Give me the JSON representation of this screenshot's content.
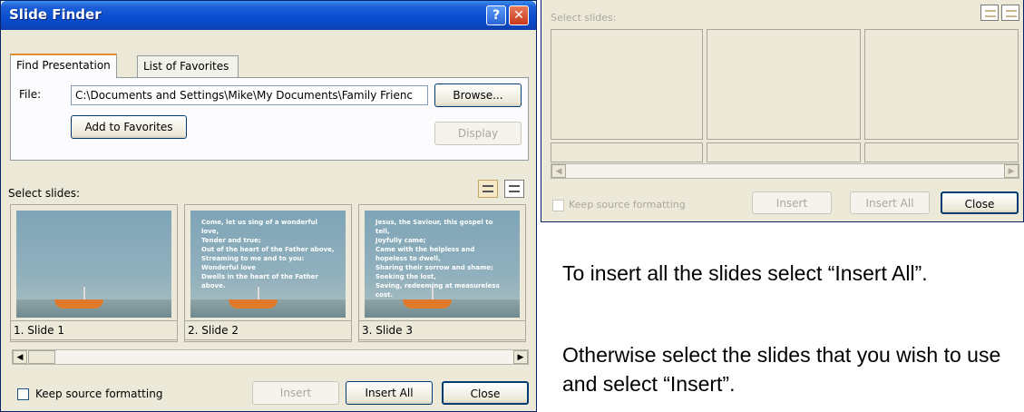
{
  "dialog": {
    "title": "Slide Finder",
    "help_glyph": "?",
    "close_glyph": "✕",
    "tabs": [
      {
        "label": "Find Presentation"
      },
      {
        "label": "List of Favorites"
      }
    ],
    "file_label": "File:",
    "file_value": "C:\\Documents and Settings\\Mike\\My Documents\\Family Frienc",
    "browse_label": "Browse...",
    "add_favorites_label": "Add to Favorites",
    "display_label": "Display",
    "select_slides_label": "Select slides:",
    "slides": [
      {
        "caption": "1. Slide 1",
        "lyric": ""
      },
      {
        "caption": "2. Slide 2",
        "lyric": "Come, let us sing of a wonderful\nlove,\nTender and true;\nOut of the heart of the Father above,\nStreaming to me and to you:\nWonderful love\nDwells in the heart of the Father\nabove."
      },
      {
        "caption": "3. Slide 3",
        "lyric": "Jesus, the Saviour, this gospel to\ntell,\nJoyfully came;\nCame with the helpless and\nhopeless to dwell,\nSharing their sorrow and shame;\nSeeking the lost,\nSaving, redeeming at measureless\ncost."
      }
    ],
    "keep_formatting_label": "Keep source formatting",
    "insert_label": "Insert",
    "insert_all_label": "Insert All",
    "close_label": "Close"
  },
  "empty_dialog": {
    "select_slides_label": "Select slides:",
    "keep_formatting_label": "Keep source formatting",
    "insert_label": "Insert",
    "insert_all_label": "Insert All",
    "close_label": "Close"
  },
  "instructions": {
    "para1": "To insert all the slides select “Insert All”.",
    "para2": "Otherwise select the slides that you wish to use and select “Insert”."
  },
  "colors": {
    "titlebar": "#0a4fd1",
    "dialog_bg": "#ece9d8",
    "tab_highlight": "#e68b2c"
  }
}
